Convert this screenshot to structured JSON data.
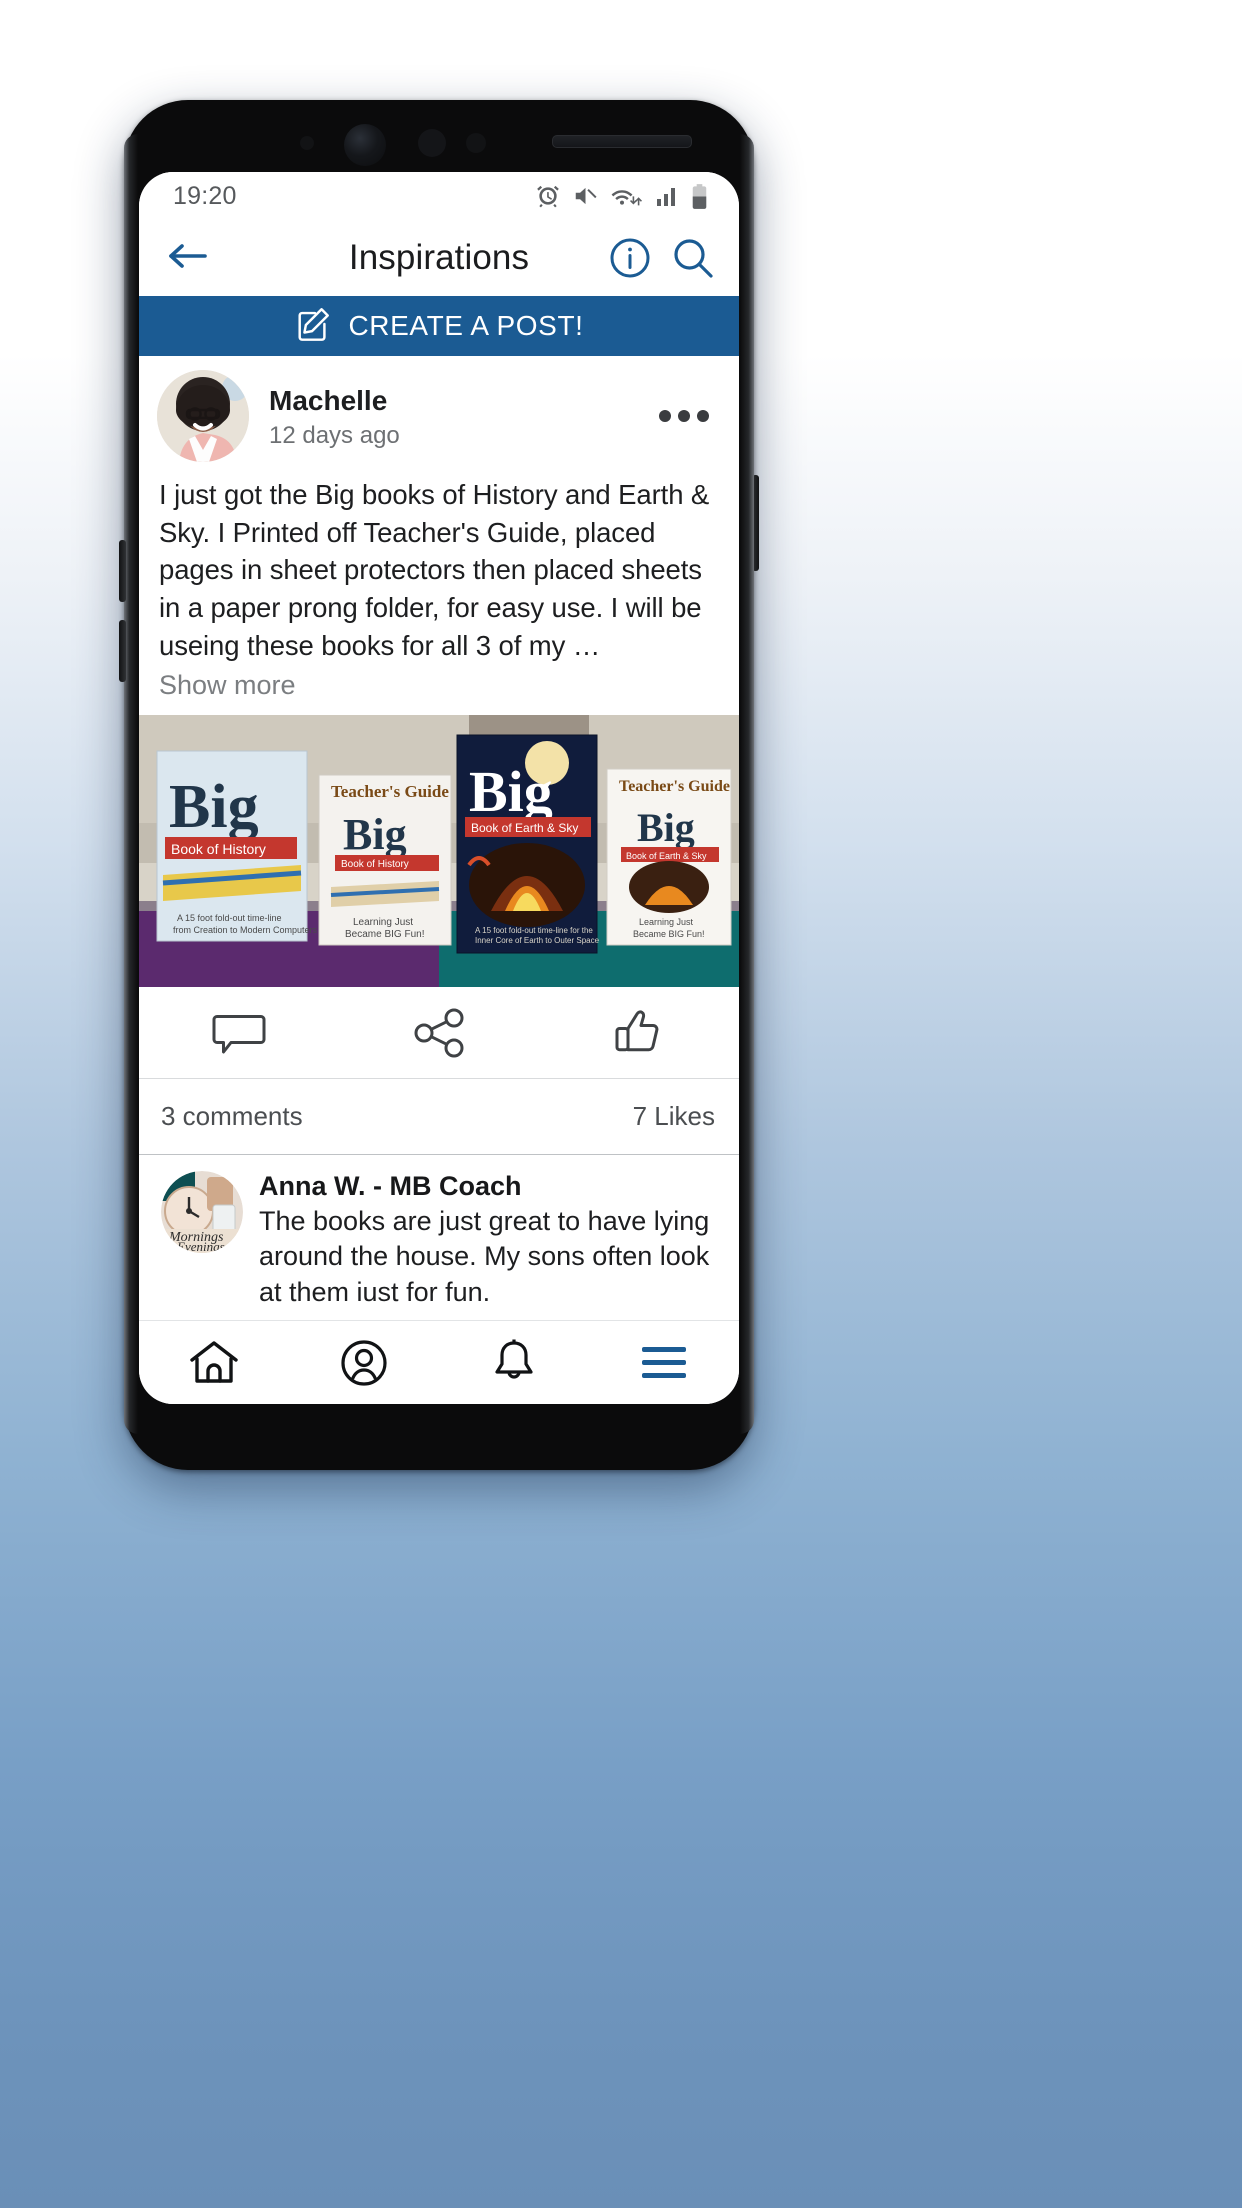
{
  "statusbar": {
    "time": "19:20",
    "icons": [
      "alarm-icon",
      "mute-icon",
      "wifi-icon",
      "signal-icon",
      "battery-icon"
    ]
  },
  "navbar": {
    "back_icon": "back-arrow-icon",
    "title": "Inspirations",
    "info_icon": "info-icon",
    "search_icon": "search-icon",
    "accent_color": "#1b5b93"
  },
  "create_bar": {
    "label": "CREATE A POST!",
    "icon": "compose-icon",
    "background": "#1b5b93"
  },
  "post": {
    "author": "Machelle",
    "timestamp": "12 days ago",
    "avatar": "user-avatar",
    "menu_icon": "more-options-icon",
    "text": "I just got the Big books of History and  Earth & Sky.  I Printed off Teacher's Guide, placed pages in sheet protectors then placed sheets in a paper prong folder, for easy use. I will be useing these books for all 3 of my …",
    "show_more": "Show more",
    "image_alt": "photo-of-big-books",
    "actions": [
      {
        "name": "comment-action",
        "icon": "comment-bubble-icon"
      },
      {
        "name": "share-action",
        "icon": "share-icon"
      },
      {
        "name": "like-action",
        "icon": "thumbs-up-icon"
      }
    ],
    "comment_count": "3 comments",
    "like_count": "7 Likes"
  },
  "comments": [
    {
      "author": "Anna W. - MB Coach",
      "avatar": "commenter-avatar",
      "text": "The books are just great to have lying around the house. My sons often look at them iust for fun."
    }
  ],
  "bottom_nav": [
    {
      "name": "nav-home",
      "icon": "home-icon"
    },
    {
      "name": "nav-profile",
      "icon": "person-circle-icon"
    },
    {
      "name": "nav-notifications",
      "icon": "bell-icon"
    },
    {
      "name": "nav-menu",
      "icon": "hamburger-menu-icon"
    }
  ]
}
